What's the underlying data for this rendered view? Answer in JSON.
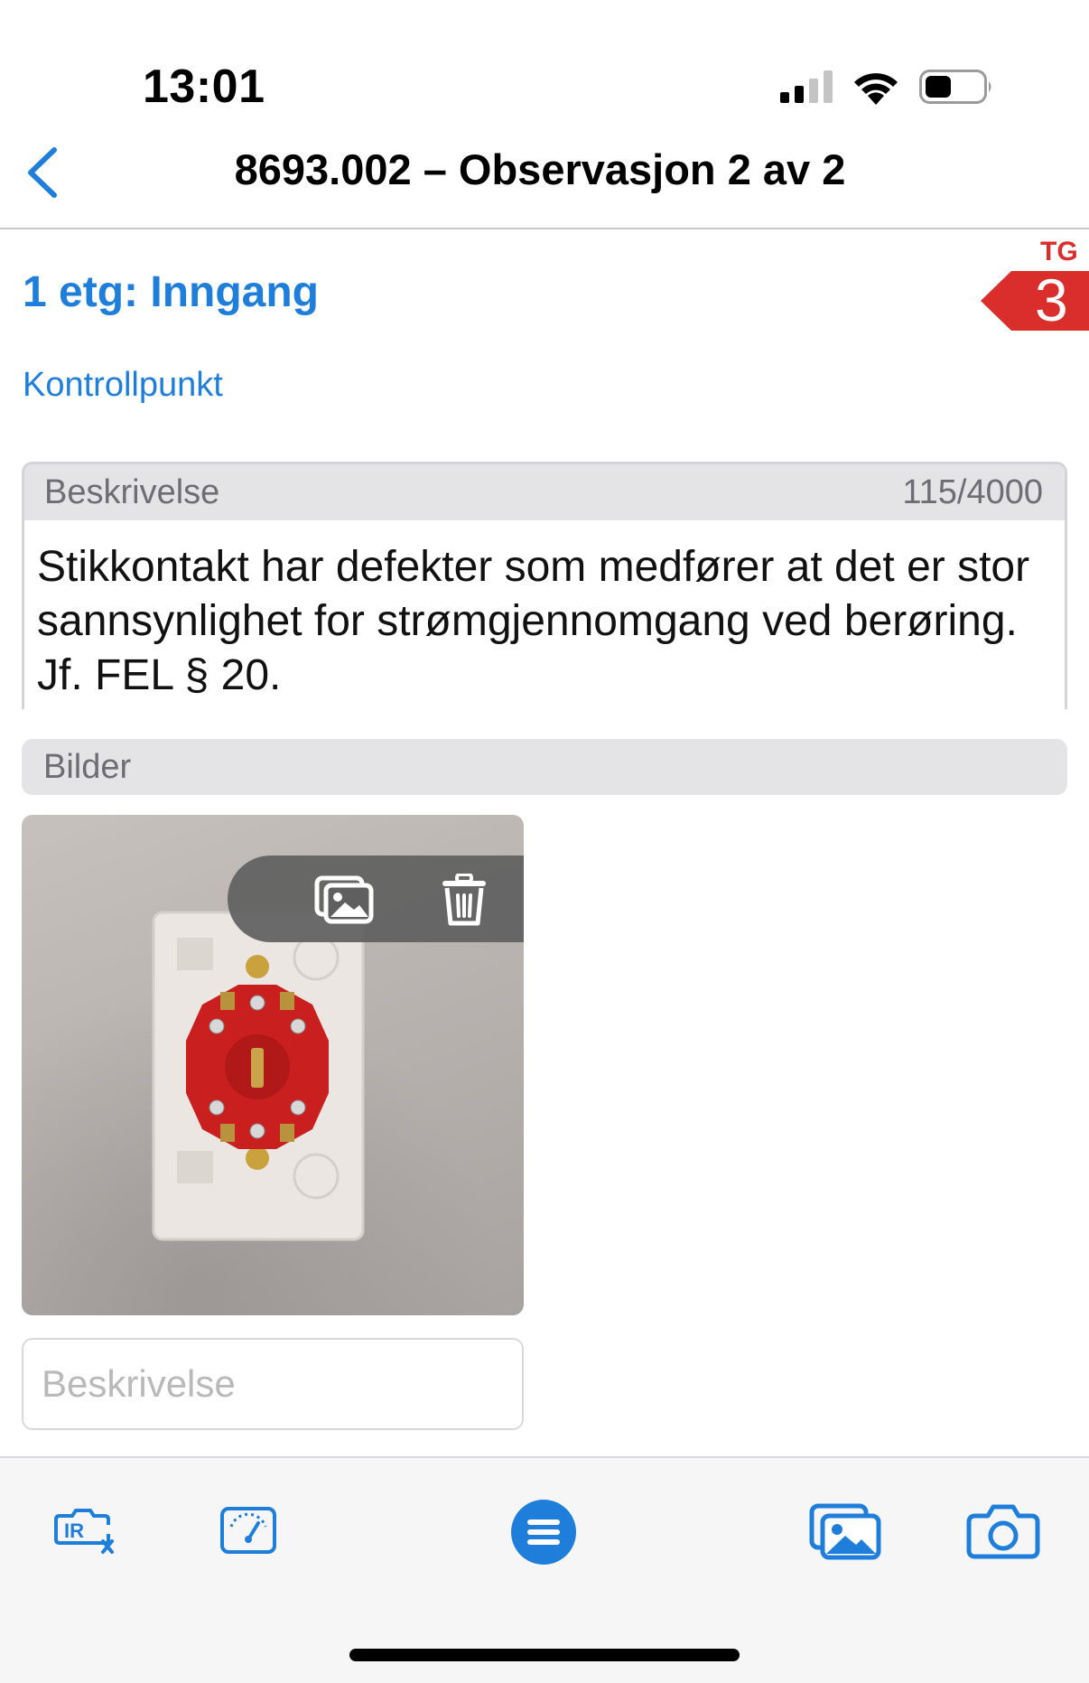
{
  "status_bar": {
    "time": "13:01"
  },
  "nav": {
    "title": "8693.002 – Observasjon 2 av 2"
  },
  "location": {
    "title": "1 etg: Inngang"
  },
  "condition": {
    "label": "TG",
    "value": "3",
    "color": "#d92e2b"
  },
  "kontrollpunkt": {
    "label": "Kontrollpunkt"
  },
  "description": {
    "label": "Beskrivelse",
    "counter": "115/4000",
    "text": "Stikkontakt har defekter som medfører at det er stor sannsynlighet for strømgjennomgang ved berøring. Jf. FEL § 20."
  },
  "images": {
    "label": "Bilder",
    "caption_placeholder": "Beskrivelse"
  },
  "icons": {
    "back": "chevron-left-icon",
    "signal": "cellular-signal-icon",
    "wifi": "wifi-icon",
    "battery": "battery-icon",
    "gallery": "photo-gallery-icon",
    "trash": "trash-icon",
    "ir": "ir-camera-icon",
    "meter": "measurement-meter-icon",
    "menu": "menu-icon",
    "photos": "photos-icon",
    "camera": "camera-icon"
  },
  "colors": {
    "accent": "#1f7ed9",
    "tg_red": "#d92e2b"
  }
}
